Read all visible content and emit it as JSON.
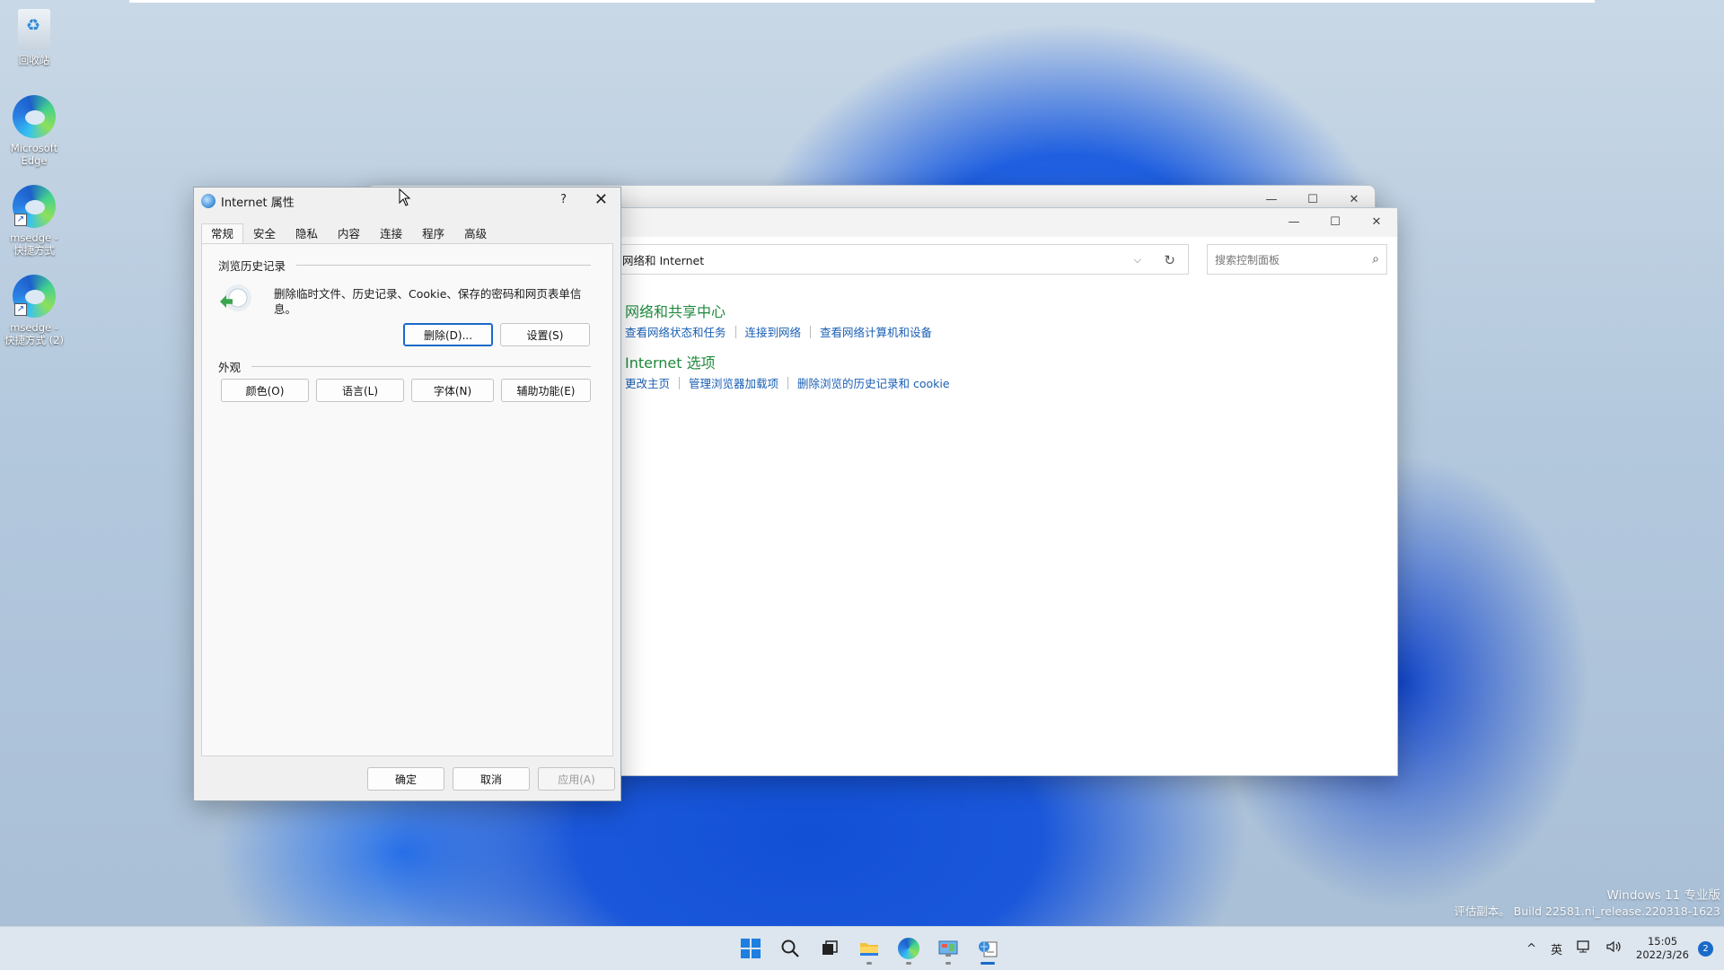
{
  "desktop": {
    "icons": [
      {
        "label": "回收站",
        "icon": "recycle-bin-icon"
      },
      {
        "label": "Microsoft Edge",
        "icon": "edge-icon"
      },
      {
        "label": "msedge - 快捷方式",
        "icon": "edge-shortcut-icon"
      },
      {
        "label": "msedge - 快捷方式 (2)",
        "icon": "edge-shortcut-icon"
      }
    ]
  },
  "control_panel": {
    "address": "网络和 Internet",
    "search_placeholder": "搜索控制面板",
    "sections": [
      {
        "title": "网络和共享中心",
        "links": [
          "查看网络状态和任务",
          "连接到网络",
          "查看网络计算机和设备"
        ]
      },
      {
        "title": "Internet 选项",
        "links": [
          "更改主页",
          "管理浏览器加载项",
          "删除浏览的历史记录和 cookie"
        ]
      }
    ],
    "accent_title_color": "#1f8a3c",
    "link_color": "#1a5fb4"
  },
  "dialog": {
    "title": "Internet 属性",
    "help": "?",
    "close": "✕",
    "tabs": [
      "常规",
      "安全",
      "隐私",
      "内容",
      "连接",
      "程序",
      "高级"
    ],
    "active_tab": "常规",
    "history_group": "浏览历史记录",
    "history_desc": "删除临时文件、历史记录、Cookie、保存的密码和网页表单信息。",
    "delete_btn": "删除(D)...",
    "settings_btn": "设置(S)",
    "appearance_group": "外观",
    "appearance_buttons": [
      "颜色(O)",
      "语言(L)",
      "字体(N)",
      "辅助功能(E)"
    ],
    "ok_btn": "确定",
    "cancel_btn": "取消",
    "apply_btn": "应用(A)"
  },
  "watermark": {
    "line1": "Windows 11 专业版",
    "line2": "评估副本。 Build 22581.ni_release.220318-1623"
  },
  "taskbar": {
    "apps": [
      "start-icon",
      "search-icon",
      "task-view-icon",
      "file-explorer-icon",
      "edge-icon",
      "control-panel-icon",
      "internet-options-icon"
    ],
    "tray": {
      "chevron": "^",
      "ime": "英",
      "time": "15:05",
      "date": "2022/3/26",
      "notifications": "2"
    }
  }
}
